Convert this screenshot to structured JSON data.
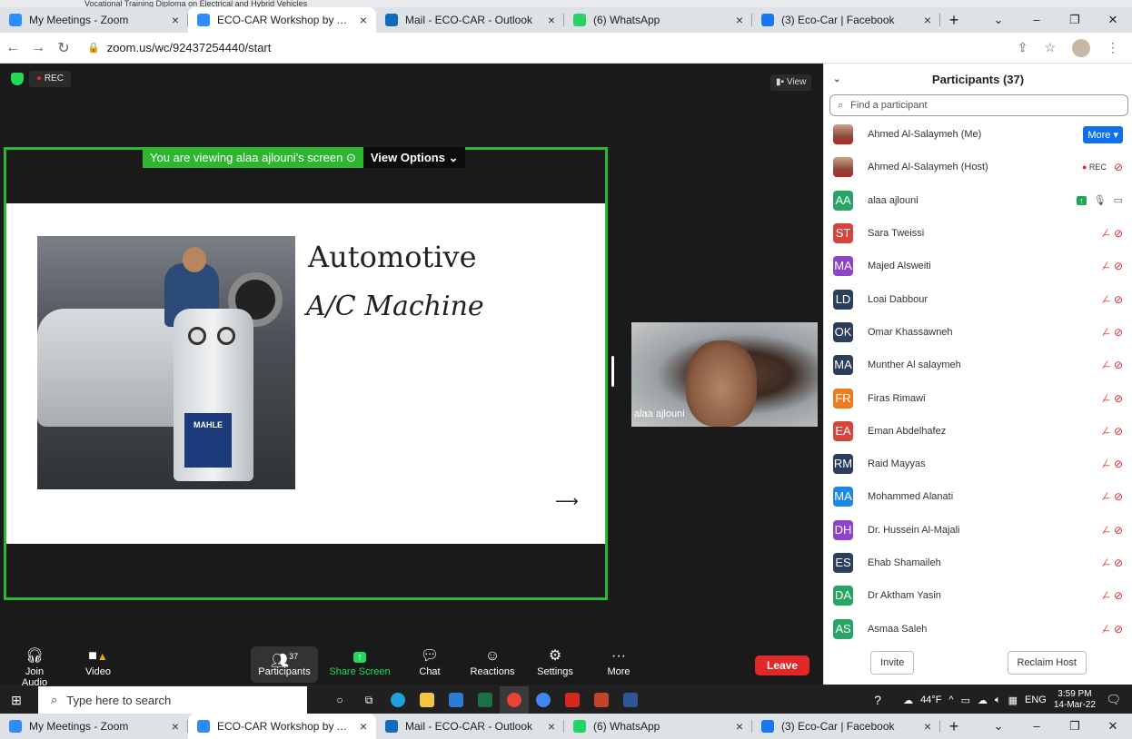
{
  "page_top_text": "Vocational Training Diploma on Electrical and Hybrid Vehicles",
  "browser": {
    "tabs": [
      {
        "title": "My Meetings - Zoom",
        "color": "#2d8cff"
      },
      {
        "title": "ECO-CAR Workshop by ASU titl",
        "color": "#2d8cff",
        "active": true
      },
      {
        "title": "Mail - ECO-CAR - Outlook",
        "color": "#0f6cbd"
      },
      {
        "title": "(6) WhatsApp",
        "color": "#25d366"
      },
      {
        "title": "(3) Eco-Car | Facebook",
        "color": "#1877f2"
      }
    ],
    "new_tab": "+",
    "url": "zoom.us/wc/92437254440/start"
  },
  "zoom": {
    "rec_label": "REC",
    "view_label": "View",
    "share_banner": "You are viewing alaa ajlouni's screen",
    "view_options": "View Options",
    "slide": {
      "title": "Automotive",
      "subtitle": "A/C Machine",
      "machine_brand": "MAHLE",
      "arrow": "⟶"
    },
    "video_name": "alaa ajlouni",
    "toolbar": {
      "join_audio": "Join Audio",
      "video": "Video",
      "participants": "Participants",
      "participants_count": "37",
      "share_screen": "Share Screen",
      "chat": "Chat",
      "reactions": "Reactions",
      "settings": "Settings",
      "more": "More",
      "leave": "Leave"
    }
  },
  "participants_panel": {
    "title": "Participants (37)",
    "search_placeholder": "Find a participant",
    "more_button": "More ▾",
    "rec_tag": "REC",
    "invite": "Invite",
    "reclaim_host": "Reclaim Host",
    "people": [
      {
        "initials": "",
        "name": "Ahmed Al-Salaymeh (Me)",
        "color": "",
        "photo": true
      },
      {
        "initials": "",
        "name": "Ahmed Al-Salaymeh (Host)",
        "color": "",
        "photo": true
      },
      {
        "initials": "AA",
        "name": "alaa ajlouni",
        "color": "#27a567"
      },
      {
        "initials": "ST",
        "name": "Sara Tweissi",
        "color": "#d9433a"
      },
      {
        "initials": "MA",
        "name": "Majed Alsweiti",
        "color": "#8e44c9"
      },
      {
        "initials": "LD",
        "name": "Loai Dabbour",
        "color": "#2b3f5c"
      },
      {
        "initials": "OK",
        "name": "Omar Khassawneh",
        "color": "#2b3f5c"
      },
      {
        "initials": "MA",
        "name": "Munther Al salaymeh",
        "color": "#2b3f5c"
      },
      {
        "initials": "FR",
        "name": "Firas Rimawi",
        "color": "#f07a1d"
      },
      {
        "initials": "EA",
        "name": "Eman Abdelhafez",
        "color": "#d9433a"
      },
      {
        "initials": "RM",
        "name": "Raid Mayyas",
        "color": "#2b3f5c"
      },
      {
        "initials": "MA",
        "name": "Mohammed Alanati",
        "color": "#1e88e5"
      },
      {
        "initials": "DH",
        "name": "Dr. Hussein Al-Majali",
        "color": "#8e44c9"
      },
      {
        "initials": "ES",
        "name": "Ehab Shamaileh",
        "color": "#2b3f5c"
      },
      {
        "initials": "DA",
        "name": "Dr Aktham Yasin",
        "color": "#27a567"
      },
      {
        "initials": "AS",
        "name": "Asmaa Saleh",
        "color": "#27a567"
      }
    ]
  },
  "taskbar": {
    "search_placeholder": "Type here to search",
    "weather": "44°F",
    "lang": "ENG",
    "time": "3:59 PM",
    "date": "14-Mar-22"
  }
}
